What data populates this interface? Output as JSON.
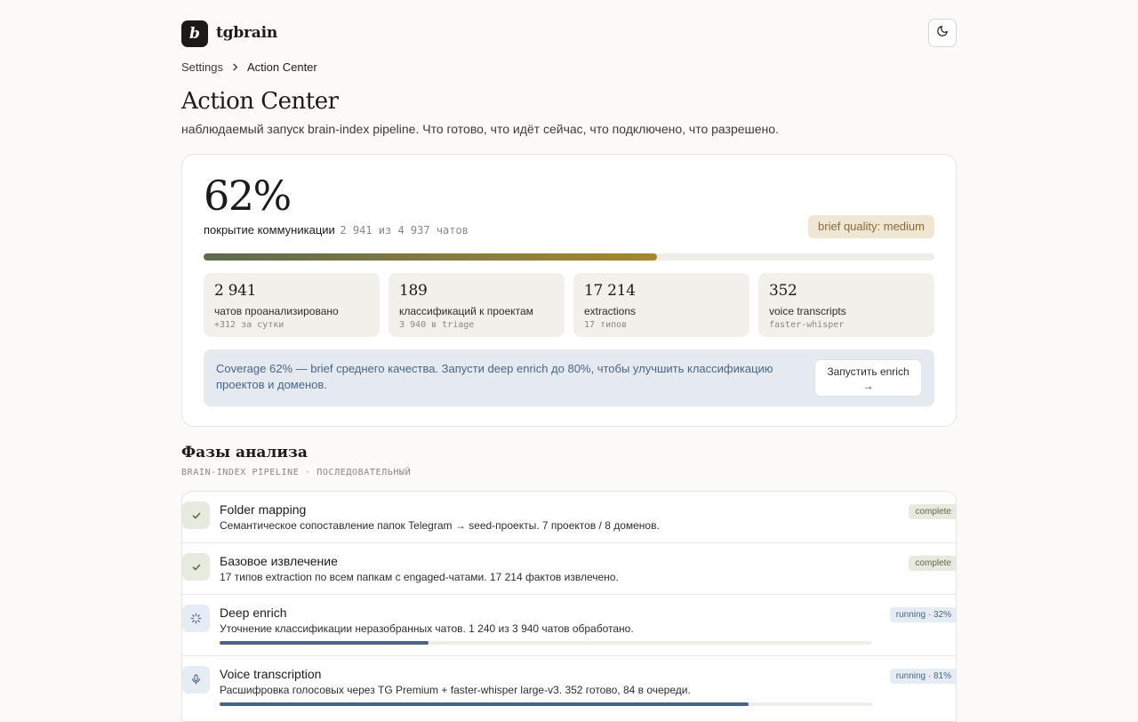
{
  "app": {
    "logo_letter": "b",
    "name": "tgbrain"
  },
  "breadcrumb": {
    "parent": "Settings",
    "current": "Action Center"
  },
  "page": {
    "title": "Action Center",
    "subtitle": "наблюдаемый запуск brain-index pipeline. Что готово, что идёт сейчас, что подключено, что разрешено."
  },
  "coverage": {
    "percent_label": "62%",
    "percent_value": 62,
    "label": "покрытие коммуникации",
    "detail": "2 941 из 4 937 чатов",
    "quality_badge": "brief quality: medium",
    "stats": [
      {
        "num": "2 941",
        "label": "чатов проанализировано",
        "sub": "+312 за сутки"
      },
      {
        "num": "189",
        "label": "классификаций к проектам",
        "sub": "3 940 в triage"
      },
      {
        "num": "17 214",
        "label": "extractions",
        "sub": "17 типов"
      },
      {
        "num": "352",
        "label": "voice transcripts",
        "sub": "faster-whisper"
      }
    ],
    "notice_text": "Coverage 62% — brief среднего качества. Запусти deep enrich до 80%, чтобы улучшить классификацию проектов и доменов.",
    "notice_button_line1": "Запустить enrich",
    "notice_button_line2": "→"
  },
  "phases": {
    "title": "Фазы анализа",
    "subtitle": "BRAIN-INDEX PIPELINE · ПОСЛЕДОВАТЕЛЬНЫЙ",
    "items": [
      {
        "name": "Folder mapping",
        "desc": "Семантическое сопоставление папок Telegram → seed-проекты. 7 проектов / 8 доменов.",
        "badge": "complete",
        "icon": "check-icon"
      },
      {
        "name": "Базовое извлечение",
        "desc": "17 типов extraction по всем папкам с engaged-чатами. 17 214 фактов извлечено.",
        "badge": "complete",
        "icon": "check-icon"
      },
      {
        "name": "Deep enrich",
        "desc": "Уточнение классификации неразобранных чатов. 1 240 из 3 940 чатов обработано.",
        "badge": "running · 32%",
        "progress": 32,
        "icon": "spinner-icon"
      },
      {
        "name": "Voice transcription",
        "desc": "Расшифровка голосовых через TG Premium + faster-whisper large-v3. 352 готово, 84 в очереди.",
        "badge": "running · 81%",
        "progress": 81,
        "icon": "microphone-icon"
      }
    ]
  },
  "colors": {
    "accent": "#4a6583",
    "complete": "#5d6a4c",
    "warning": "#8a6a3a"
  }
}
